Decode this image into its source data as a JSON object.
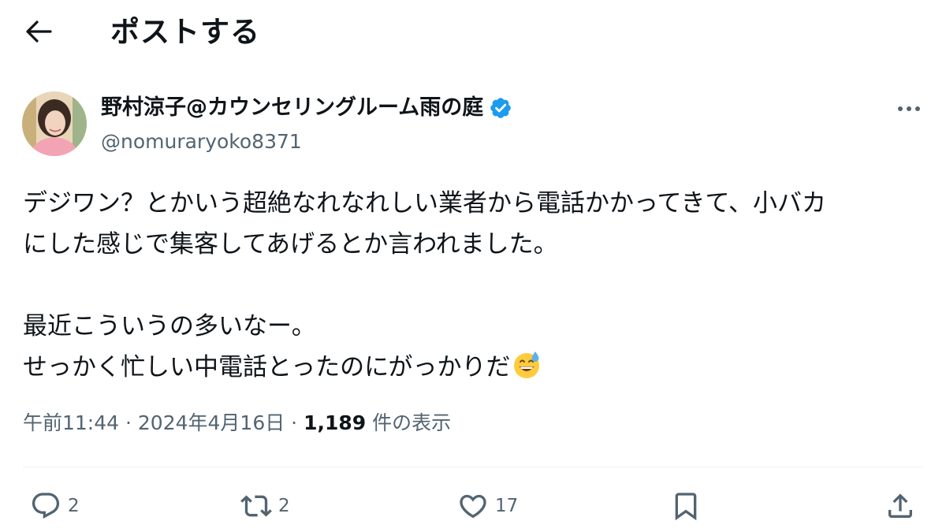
{
  "header": {
    "back_icon": "arrow-left-icon",
    "title": "ポストする"
  },
  "author": {
    "display_name": "野村涼子@カウンセリングルーム雨の庭",
    "handle": "@nomuraryoko8371",
    "verified": true,
    "verified_color": "#1d9bf0"
  },
  "post": {
    "line1": "デジワン？とかいう超絶なれなれしい業者から電話かかってきて、小バカ",
    "line2": "にした感じで集客してあげるとか言われました。",
    "line3": "最近こういうの多いなー。",
    "line4": "せっかく忙しい中電話とったのにがっかりだ",
    "emoji": "grinning-face-with-sweat"
  },
  "meta": {
    "time": "午前11:44",
    "sep1": " · ",
    "date": "2024年4月16日",
    "sep2": " · ",
    "views_count": "1,189",
    "views_label": " 件の表示"
  },
  "actions": {
    "reply_count": "2",
    "repost_count": "2",
    "like_count": "17"
  },
  "colors": {
    "text": "#0f1419",
    "secondary": "#536471",
    "accent": "#1d9bf0",
    "divider": "#eff3f4"
  }
}
